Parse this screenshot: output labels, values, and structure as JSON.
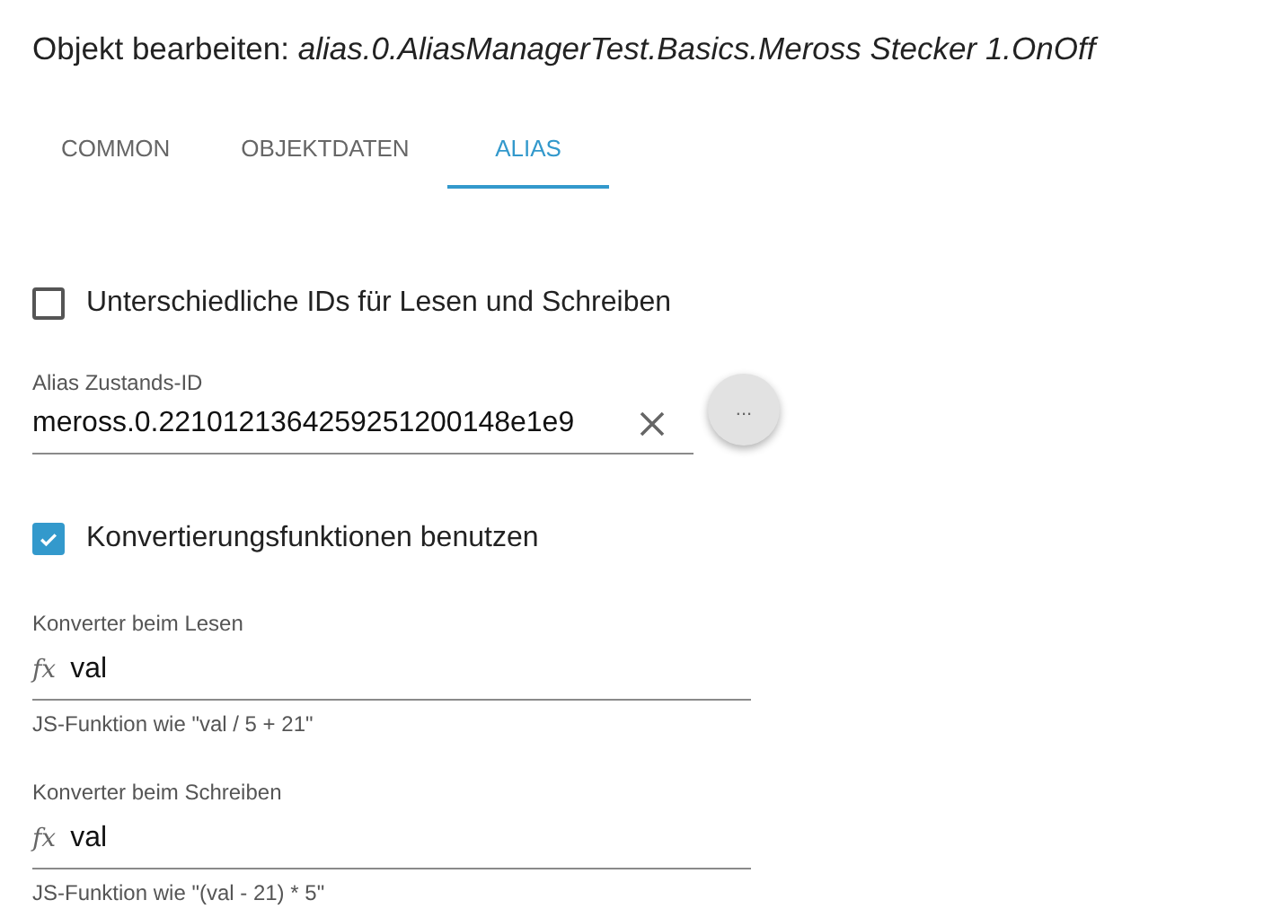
{
  "dialog": {
    "title": "Objekt bearbeiten: *alias.0.AliasManagerTest.Basics.Meross Stecker 1.OnOff*"
  },
  "tabs": [
    {
      "label": "COMMON",
      "selected": false
    },
    {
      "label": "OBJEKTDATEN",
      "selected": false
    },
    {
      "label": "ALIAS",
      "selected": true
    }
  ],
  "separate_ids": {
    "label": "Unterschiedliche IDs für Lesen und Schreiben",
    "checked": false
  },
  "alias_state_id": {
    "label": "Alias Zustands-ID",
    "value": "meross.0.2210121364259251200148e1e9",
    "browse_button": "..."
  },
  "use_converters": {
    "label": "Konvertierungsfunktionen benutzen",
    "checked": true
  },
  "converters": [
    {
      "label": "Konverter beim Lesen",
      "prefix": "fx",
      "value": "val",
      "helper": "JS-Funktion wie \"val / 5 + 21\""
    },
    {
      "label": "Konverter beim Schreiben",
      "prefix": "fx",
      "value": "val",
      "helper": "JS-Funktion wie \"(val - 21) * 5\""
    }
  ]
}
